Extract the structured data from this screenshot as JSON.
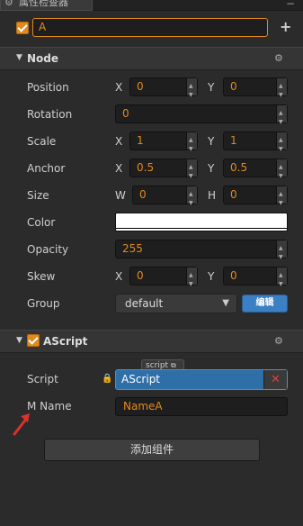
{
  "tab": {
    "title": "属性检查器"
  },
  "node": {
    "name": "A"
  },
  "node_section": {
    "title": "Node"
  },
  "rows": {
    "position": {
      "label": "Position",
      "x_label": "X",
      "x": "0",
      "y_label": "Y",
      "y": "0"
    },
    "rotation": {
      "label": "Rotation",
      "value": "0"
    },
    "scale": {
      "label": "Scale",
      "x_label": "X",
      "x": "1",
      "y_label": "Y",
      "y": "1"
    },
    "anchor": {
      "label": "Anchor",
      "x_label": "X",
      "x": "0.5",
      "y_label": "Y",
      "y": "0.5"
    },
    "size": {
      "label": "Size",
      "w_label": "W",
      "w": "0",
      "h_label": "H",
      "h": "0"
    },
    "color": {
      "label": "Color",
      "value": "#ffffff"
    },
    "opacity": {
      "label": "Opacity",
      "value": "255"
    },
    "skew": {
      "label": "Skew",
      "x_label": "X",
      "x": "0",
      "y_label": "Y",
      "y": "0"
    },
    "group": {
      "label": "Group",
      "value": "default",
      "edit_label": "编辑"
    }
  },
  "ascript_section": {
    "title": "AScript"
  },
  "ascript": {
    "script_label": "Script",
    "script_tag": "script",
    "script_value": "AScript",
    "mname_label": "M Name",
    "mname_value": "NameA"
  },
  "add_component": {
    "label": "添加组件"
  },
  "colors": {
    "accent": "#e08a1e",
    "script_blue": "#2f6fa8",
    "background": "#2b2b2b"
  }
}
